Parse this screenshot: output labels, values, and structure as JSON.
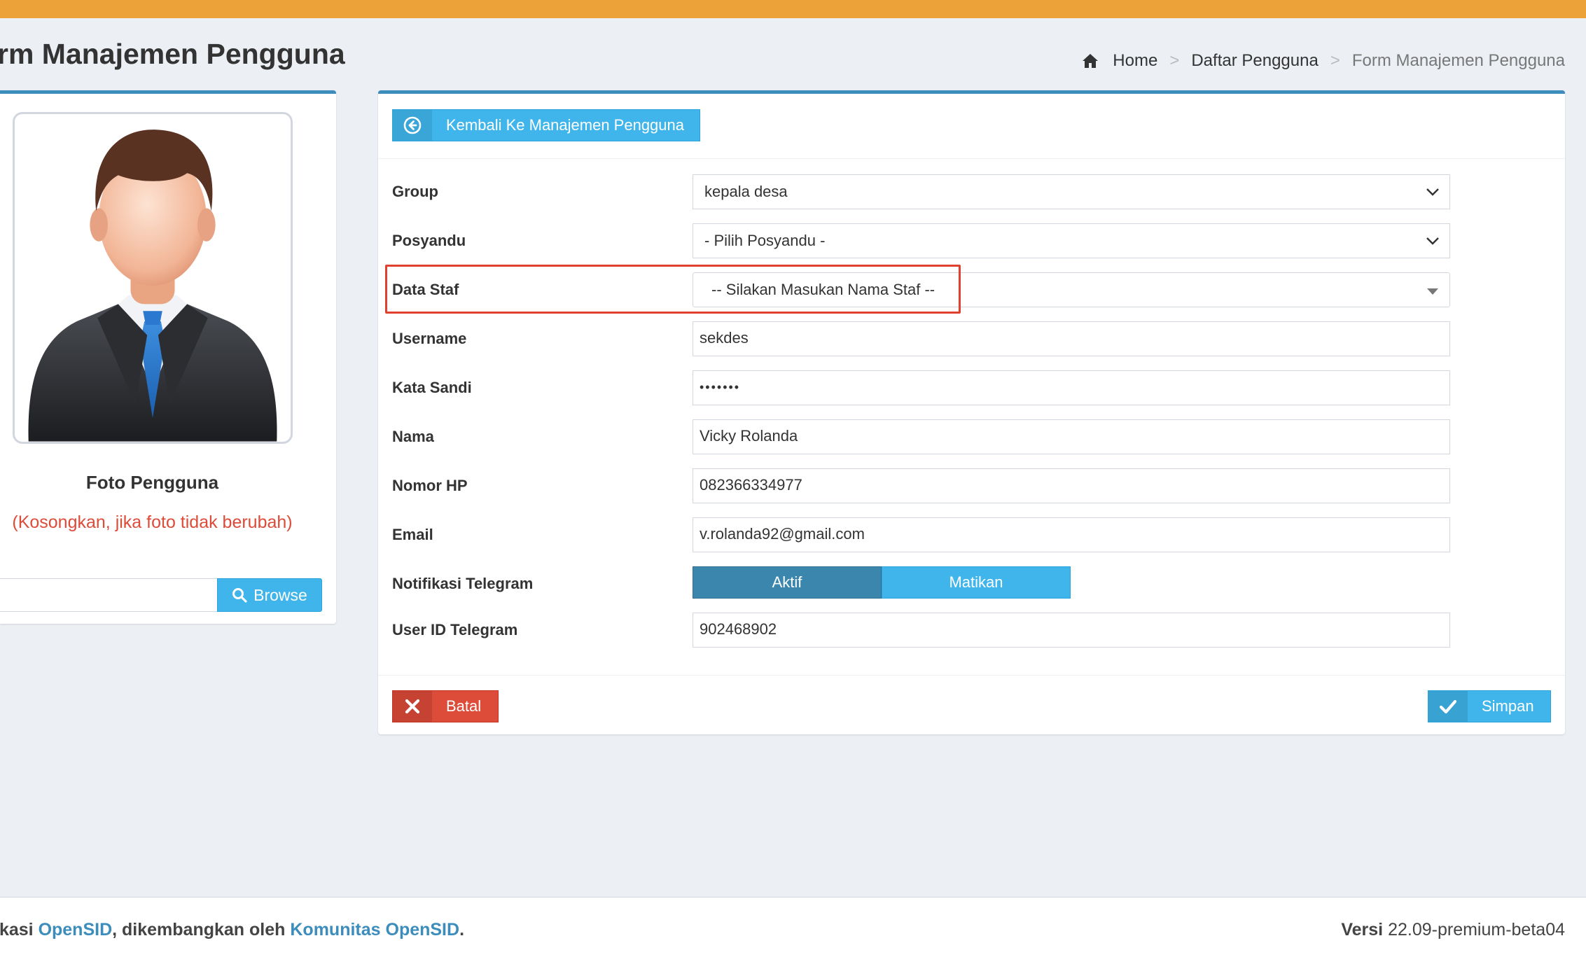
{
  "header": {
    "page_title": "rm Manajemen Pengguna",
    "breadcrumb": {
      "home": "Home",
      "parent": "Daftar Pengguna",
      "current": "Form Manajemen Pengguna",
      "separator": ">"
    }
  },
  "photo_panel": {
    "label": "Foto Pengguna",
    "hint": "(Kosongkan, jika foto tidak berubah)",
    "file_input_value": "",
    "browse_label": "Browse"
  },
  "form": {
    "back_button": "Kembali Ke Manajemen Pengguna",
    "fields": {
      "group": {
        "label": "Group",
        "value": "kepala desa"
      },
      "posyandu": {
        "label": "Posyandu",
        "value": "- Pilih Posyandu -"
      },
      "data_staf": {
        "label": "Data Staf",
        "value": "-- Silakan Masukan Nama Staf --"
      },
      "username": {
        "label": "Username",
        "value": "sekdes"
      },
      "kata_sandi": {
        "label": "Kata Sandi",
        "value": "•••••••"
      },
      "nama": {
        "label": "Nama",
        "value": "Vicky Rolanda"
      },
      "nomor_hp": {
        "label": "Nomor HP",
        "value": "082366334977"
      },
      "email": {
        "label": "Email",
        "value": "v.rolanda92@gmail.com"
      },
      "notifikasi_telegram": {
        "label": "Notifikasi Telegram",
        "options": [
          "Aktif",
          "Matikan"
        ],
        "selected": "Aktif"
      },
      "user_id_telegram": {
        "label": "User ID Telegram",
        "value": "902468902"
      }
    },
    "cancel_button": "Batal",
    "save_button": "Simpan"
  },
  "footer": {
    "prefix": "ikasi ",
    "link1": "OpenSID",
    "middle": ", dikembangkan oleh ",
    "link2": "Komunitas OpenSID",
    "suffix": ".",
    "version_label": "Versi",
    "version_value": "22.09-premium-beta04"
  },
  "colors": {
    "top_bar": "#eca139",
    "primary": "#3c8dbc",
    "info": "#3fb5eb",
    "danger": "#dd4b39",
    "highlight": "#e0412f"
  }
}
